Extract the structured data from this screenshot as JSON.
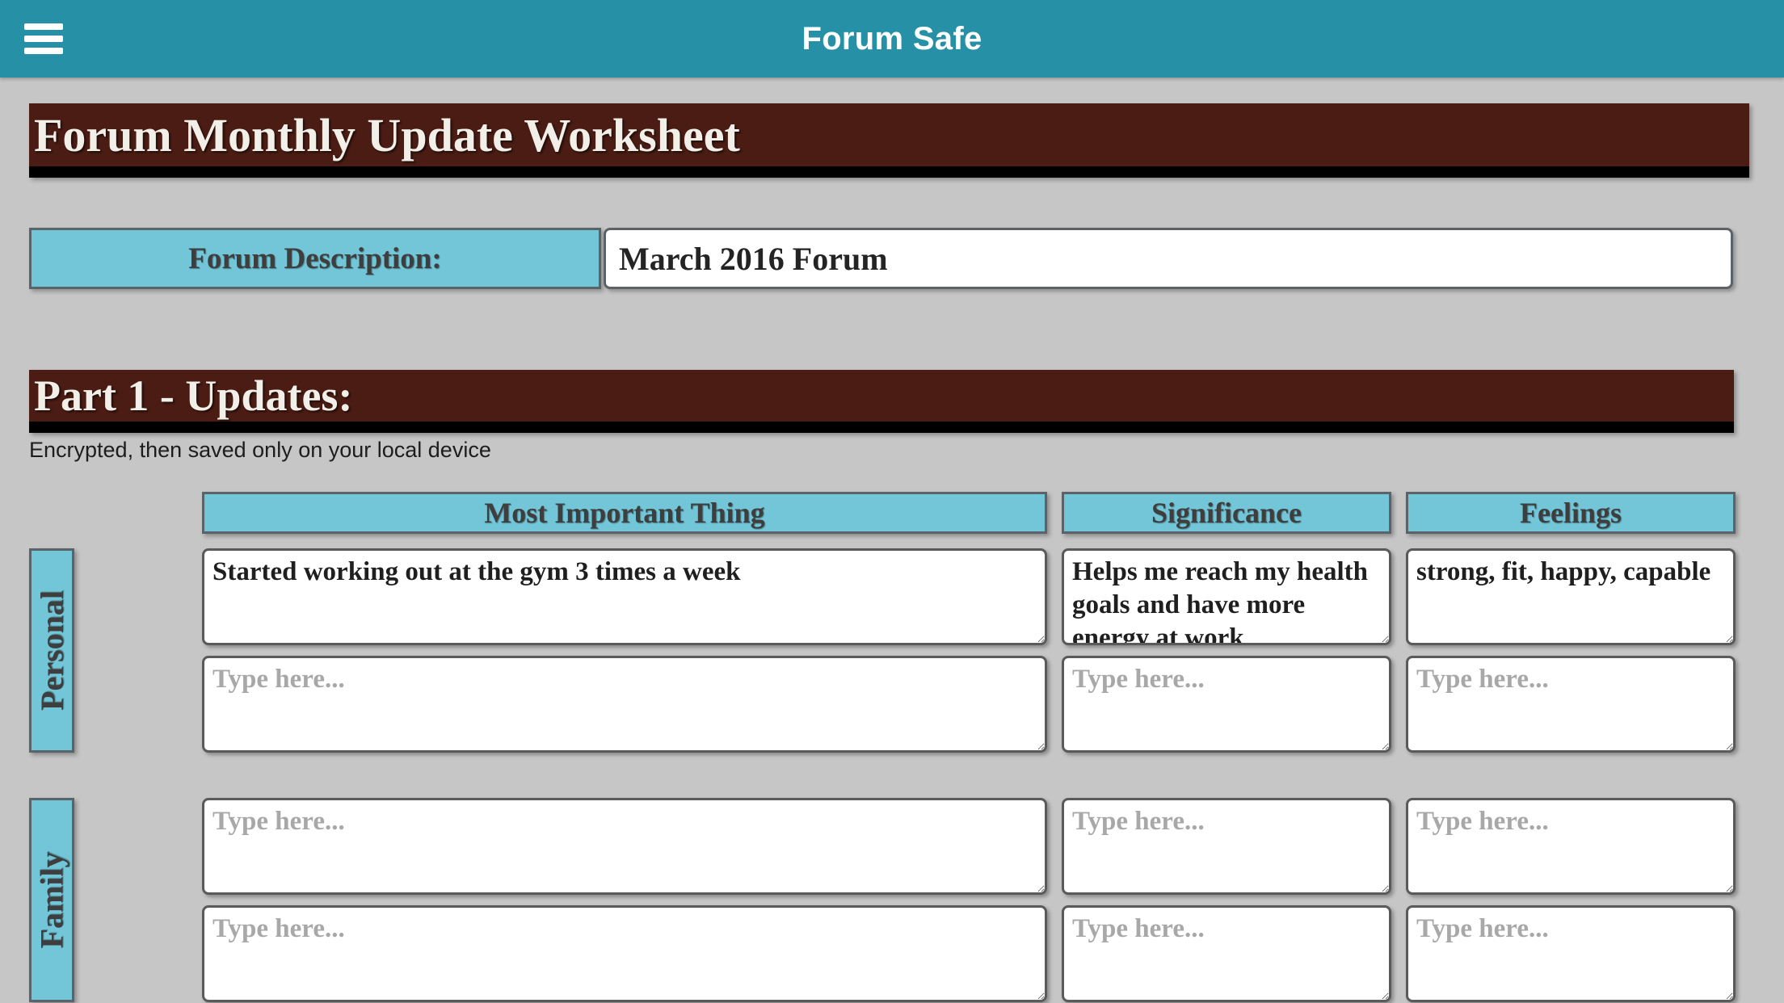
{
  "appbar": {
    "title": "Forum Safe",
    "menu_icon": "hamburger-menu-icon",
    "background_color": "#2590a6"
  },
  "worksheet_title": "Forum Monthly Update Worksheet",
  "description": {
    "label": "Forum Description:",
    "value": "March 2016 Forum",
    "placeholder": "Type here..."
  },
  "part1": {
    "heading": "Part 1 - Updates:",
    "note": "Encrypted, then saved only on your local device"
  },
  "columns": [
    {
      "label": "Most Important Thing"
    },
    {
      "label": "Significance"
    },
    {
      "label": "Feelings"
    }
  ],
  "placeholder": "Type here...",
  "rows": [
    {
      "label": "Personal",
      "entries": [
        {
          "most_important_thing": "Started working out at the gym 3 times a week",
          "significance": "Helps me reach my health goals and have more energy at work",
          "feelings": "strong, fit, happy, capable"
        },
        {
          "most_important_thing": "",
          "significance": "",
          "feelings": ""
        }
      ]
    },
    {
      "label": "Family",
      "entries": [
        {
          "most_important_thing": "",
          "significance": "",
          "feelings": ""
        },
        {
          "most_important_thing": "",
          "significance": "",
          "feelings": ""
        }
      ]
    }
  ],
  "colors": {
    "teal_appbar": "#2590a6",
    "maroon_banner": "#4a1c13",
    "light_blue": "#72c6d8",
    "page_background": "#c6c6c6",
    "border_gray": "#5a6468"
  }
}
